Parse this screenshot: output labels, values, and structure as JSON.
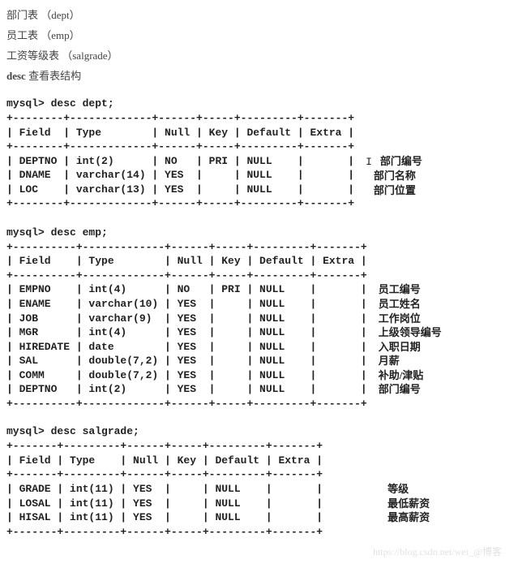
{
  "intro": {
    "line1": "部门表 （dept）",
    "line2": "员工表 （emp）",
    "line3": "工资等级表 （salgrade）",
    "line4a": "desc",
    "line4b": " 查看表结构"
  },
  "table1": {
    "prompt": "mysql> desc dept;",
    "border_top": "+--------+-------------+------+-----+---------+-------+",
    "header": "| Field  | Type        | Null | Key | Default | Extra |",
    "border_mid": "+--------+-------------+------+-----+---------+-------+",
    "rows": [
      "| DEPTNO | int(2)      | NO   | PRI | NULL    |       |",
      "| DNAME  | varchar(14) | YES  |     | NULL    |       |",
      "| LOC    | varchar(13) | YES  |     | NULL    |       |"
    ],
    "border_bot": "+--------+-------------+------+-----+---------+-------+",
    "annots": [
      "部门编号",
      "部门名称",
      "部门位置"
    ],
    "cursor": "I"
  },
  "table2": {
    "prompt": "mysql> desc emp;",
    "border_top": "+----------+-------------+------+-----+---------+-------+",
    "header": "| Field    | Type        | Null | Key | Default | Extra |",
    "border_mid": "+----------+-------------+------+-----+---------+-------+",
    "rows": [
      "| EMPNO    | int(4)      | NO   | PRI | NULL    |       |",
      "| ENAME    | varchar(10) | YES  |     | NULL    |       |",
      "| JOB      | varchar(9)  | YES  |     | NULL    |       |",
      "| MGR      | int(4)      | YES  |     | NULL    |       |",
      "| HIREDATE | date        | YES  |     | NULL    |       |",
      "| SAL      | double(7,2) | YES  |     | NULL    |       |",
      "| COMM     | double(7,2) | YES  |     | NULL    |       |",
      "| DEPTNO   | int(2)      | YES  |     | NULL    |       |"
    ],
    "border_bot": "+----------+-------------+------+-----+---------+-------+",
    "annots": [
      "员工编号",
      "员工姓名",
      "工作岗位",
      "上级领导编号",
      "入职日期",
      "月薪",
      "补助/津贴",
      "部门编号"
    ]
  },
  "table3": {
    "prompt": "mysql> desc salgrade;",
    "border_top": "+-------+---------+------+-----+---------+-------+",
    "header": "| Field | Type    | Null | Key | Default | Extra |",
    "border_mid": "+-------+---------+------+-----+---------+-------+",
    "rows": [
      "| GRADE | int(11) | YES  |     | NULL    |       |",
      "| LOSAL | int(11) | YES  |     | NULL    |       |",
      "| HISAL | int(11) | YES  |     | NULL    |       |"
    ],
    "border_bot": "+-------+---------+------+-----+---------+-------+",
    "annots": [
      "等级",
      "最低薪资",
      "最高薪资"
    ]
  },
  "watermark": "https://blog.csdn.net/wei_@博客"
}
